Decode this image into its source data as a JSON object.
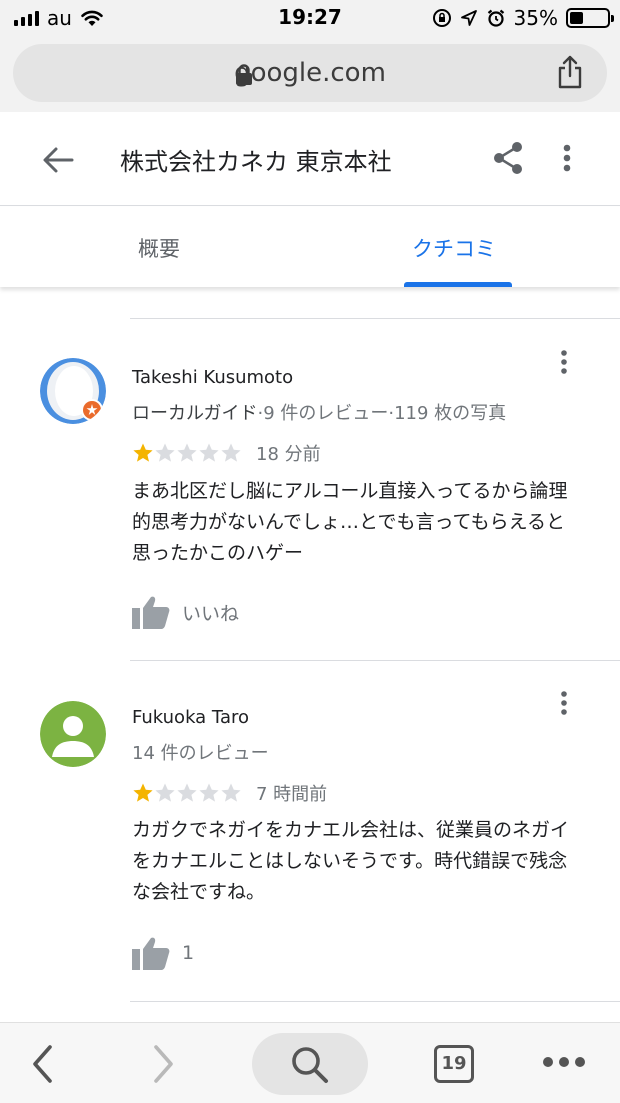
{
  "status_bar": {
    "carrier": "au",
    "time": "19:27",
    "battery_percent": "35%",
    "battery_level": 0.35
  },
  "browser": {
    "url_domain": "google.com",
    "open_tabs": "19"
  },
  "place": {
    "title": "株式会社カネカ 東京本社"
  },
  "tabs": [
    {
      "label": "概要",
      "active": false
    },
    {
      "label": "クチコミ",
      "active": true
    }
  ],
  "colors": {
    "accent": "#1a73e8",
    "star_filled": "#f4b400",
    "star_empty": "#dadce0",
    "local_guide_badge": "#ea6b2c",
    "avatar_blue": "#4a8fe0",
    "avatar_green": "#7cb342"
  },
  "reviews": [
    {
      "reviewer": "Takeshi Kusumoto",
      "meta_role": "ローカルガイド",
      "meta_counts": "·9 件のレビュー·119 枚の写真",
      "rating": 1,
      "max_rating": 5,
      "time": "18 分前",
      "text": "まあ北区だし脳にアルコール直接入ってるから論理的思考力がないんでしょ…とでも言ってもらえると思ったかこのハゲー",
      "like_label": "いいね",
      "avatar_icon": "local-guide-avatar"
    },
    {
      "reviewer": "Fukuoka Taro",
      "meta_counts": "14 件のレビュー",
      "rating": 1,
      "max_rating": 5,
      "time": "7 時間前",
      "text": "カガクでネガイをカナエル会社は、従業員のネガイをカナエルことはしないそうです。時代錯誤で残念な会社ですね。",
      "like_count": "1",
      "avatar_icon": "default-person-avatar"
    }
  ]
}
